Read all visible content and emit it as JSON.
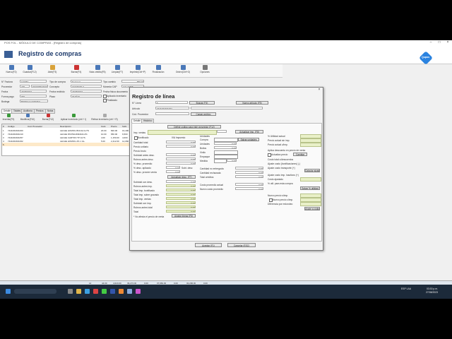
{
  "window": {
    "title": "POS FOL - MÓDULO DE COMPRAS - [Registro de compras]"
  },
  "header": {
    "title": "Registro de compras",
    "logo": "Qupos"
  },
  "toolbar": [
    {
      "label": "Nuevo(F2)"
    },
    {
      "label": "Guardar(F12)"
    },
    {
      "label": "Abrir(F3)"
    },
    {
      "label": "Borrar(F4)"
    },
    {
      "label": "Nota crédito(F5)"
    },
    {
      "label": "Limpiar(F7)"
    },
    {
      "label": "Imprimir(Ctrl+P)"
    },
    {
      "label": "Finalización"
    },
    {
      "label": "Orden(Ctrl+O)"
    },
    {
      "label": "Opciones"
    }
  ],
  "form": {
    "numero_factura_label": "N° Factura",
    "numero_factura": "123457",
    "proveedor_label": "Proveedor",
    "proveedor_code": "225",
    "proveedor_name": "DISTRIBUIDORA S.L.",
    "fecha_label": "Fecha",
    "fecha": "27/08/2023",
    "forma_pago_label": "Forma pago",
    "forma_pago": "030",
    "bodega_label": "Bodega",
    "bodega": "BODEGA GENERAL",
    "tipo_compra_label": "Tipo de compra",
    "tipo_compra": "Nacional",
    "concepto_label": "Concepto",
    "concepto": "0100/0000-0",
    "fecha_recibido_label": "Fecha recibido",
    "fecha_recibido": "27/08/2023",
    "plazo_label": "Plazo",
    "plazo": "30 DÍAS",
    "tipo_cambio_label": "Tipo cambio",
    "tipo_cambio": "580.00",
    "moneda_label": "Moneda CAP",
    "moneda": "COLONES",
    "fecha_fisica_label": "Fecha física documento",
    "aplicado_label": "Aplicado inventario",
    "finalizado_label": "Finalizado"
  },
  "tabs": [
    "Detalle",
    "Totales",
    "Auditoría",
    "Precios",
    "Notas"
  ],
  "detail_toolbar": [
    "Insertar(F9)",
    "Modificar(F10)",
    "Borrar(F12)",
    "Aplicar inventario (ctrl + I)",
    "Retirar inventario (ctrl + R)",
    "Exportar detalle"
  ],
  "grid": {
    "columns": [
      "#",
      "Código",
      "Cód. Proveedor",
      "Descripción",
      "Cant.",
      "Precio",
      "Subt."
    ],
    "rows": [
      [
        "1",
        "7441001601000",
        "",
        "LECHE HOMOG BOLSA 1LTS",
        "20.00",
        "820.00",
        "16,400"
      ],
      [
        "2",
        "7441001601010",
        "",
        "LECHE PASTEURIZADA 2%",
        "10.00",
        "650.00",
        "6,500"
      ],
      [
        "3",
        "7441001601057",
        "",
        "LECHE CARTON TP 1LTS",
        "4.00",
        "1,150.00",
        "4,600"
      ],
      [
        "4",
        "7441001601062",
        "",
        "LECHE HOMOG 2% 1 GL",
        "5.00",
        "2,412.00",
        "12,060"
      ],
      [
        "5",
        "",
        "",
        "",
        "",
        "",
        ""
      ]
    ]
  },
  "status": [
    "14",
    "44.00",
    "4,620.00",
    "39,274.00",
    "0.00",
    "37,981.00",
    "0.00",
    "32,200.00",
    "0.00"
  ],
  "taskbar": {
    "lang": "ESP LAA",
    "time": "03:30 p.m.",
    "date": "27/08/2023"
  },
  "dialog": {
    "title": "Registro de línea",
    "linea_label": "N° Línea",
    "linea": "5",
    "buscar_label": "Buscar (F4)",
    "nuevo_articulo_label": "Nuevo artículo (F5)",
    "articulo_label": "Artículo",
    "articulo": "7441001601062",
    "cod_proveedor_label": "Cód. Proveedor",
    "cargar_archivo_label": "Cargar archivo",
    "tabs": [
      "Detalle",
      "Histórico"
    ],
    "definir_codigo_label": "Definir código para este proveedor (F12)",
    "imp_ventas_label": "Imp. ventas",
    "actualizar_imp_label": "Actualizar imp. (F8)",
    "bonificado_label": "Bonificado",
    "iva_label": "IVA Impuesto",
    "cantidad_total_label": "Cantidad total",
    "cantidad_total": "0.00",
    "precio_unitario_label": "Precio unitario",
    "precio_unitario": "0.00",
    "precio_bruto_label": "Precio bruto",
    "subtotal_antes_desc_label": "Subtotal antes desc.",
    "subtotal_antes_desc": "0.00",
    "rubros_antes_desc_label": "Rubros antes desc.",
    "rubros_antes_desc": "0.00",
    "desc_promedio_label": "% desc. promedio",
    "desc_promedio": "0.00",
    "desc_aplicado_label": "% desc. aplicado",
    "desc_aplicado": "0.00",
    "desc_ajuste_label": "% desc. proveer venta",
    "desc_ajuste": "0.00",
    "subt_desc_label": "Subt. desc",
    "actualizar_desc_label": "Actualizar desc. (F7)",
    "subtotal_con_desc_label": "Subtotal con desc.",
    "subtotal_con_desc": "0.00",
    "rubros_antes_imp_label": "Rubros antes imp.",
    "rubros_antes_imp": "0.00",
    "total_imp_bonificado_label": "Total imp. bonificado",
    "total_imp_bonificado": "0.00",
    "total_imp_gravado_label": "Total imp. sobre gravado",
    "total_imp_gravado": "0.00",
    "total_imp_ventas_label": "Total imp. ventas",
    "total_imp_ventas": "0.00",
    "subtotal_con_imp_label": "Subtotal con imp.",
    "subtotal_con_imp": "0.00",
    "rubros_antes_total_label": "Rubros antes total",
    "rubros_antes_total": "0.00",
    "total_label": "Total",
    "total": "0.00",
    "nota_afecta_label": "* No afecta el precio de venta",
    "ajustar_lineas_label": "Ajustar líneas (F5)",
    "unidades_label": "Unidades",
    "compra_label": "Compra",
    "salvar_unidades_label": "Salvar unidades",
    "unidades_field_label": "Unidades",
    "unidades_value": "0.00",
    "bultos_label": "Bultos",
    "bultos_value": "0.00",
    "vinilo_label": "Vinilo",
    "empaque_label": "Empaque",
    "medida_label": "Medida",
    "medida_value": "0.00",
    "cantidad_no_entregada_label": "Cantidad no entregada",
    "cantidad_no_entregada": "0.00",
    "cantidad_rechazada_label": "Cantidad rechazada",
    "cantidad_rechazada": "0.00",
    "total_creditos_label": "Total créditos",
    "total_creditos": "0.00",
    "costo_prom_actual_label": "Costo promedio actual",
    "costo_prom_actual": "0.00",
    "nuevo_costo_prom_label": "Nuevo costo promedio",
    "nuevo_costo_prom": "0.00",
    "utilidad_actual_label": "% Utilidad actual",
    "precio_actual_imp_label": "Precio actual sin imp.",
    "precio_actual_cimp_label": "Precio actual c/imp.",
    "aplica_descuento_label": "Aplica descuento en precio de venta",
    "actualiza_precio_label": "Actualiza precio",
    "cambiar_label": "Cambiar",
    "costo_total_desc_label": "Costo total c/descuentos",
    "ajuste_costo_bonif_label": "Ajuste costo (bonificaciones) (-)",
    "ajuste_costo_transp_label": "Ajuste costo transporte (+)",
    "calcular_ajuste_label": "Calcular ajuste",
    "ajuste_costo_imp_label": "Ajuste costo imp. inactivos (+)",
    "costo_ajustado_label": "Costo ajustado",
    "util_para_compra_label": "% util. para esta compra",
    "salvar_utilidad_label": "Salvar % utilidad",
    "nuevo_precio_sin_imp_label": "Nuevo precio s/imp.",
    "nuevo_precio_cimp_label": "Nuevo precio c/imp.",
    "diferencia_redondeo_label": "Diferencia por redondeo",
    "ajuste_codigo_label": "Ajuste a código",
    "aceptar_label": "Aceptar (F1)",
    "cancelar_label": "Cancelar (ESC)"
  },
  "colors": {
    "accent": "#1d3a6b",
    "dialog_green": "#e9f0c8",
    "taskbar": "#1c2a3a"
  }
}
